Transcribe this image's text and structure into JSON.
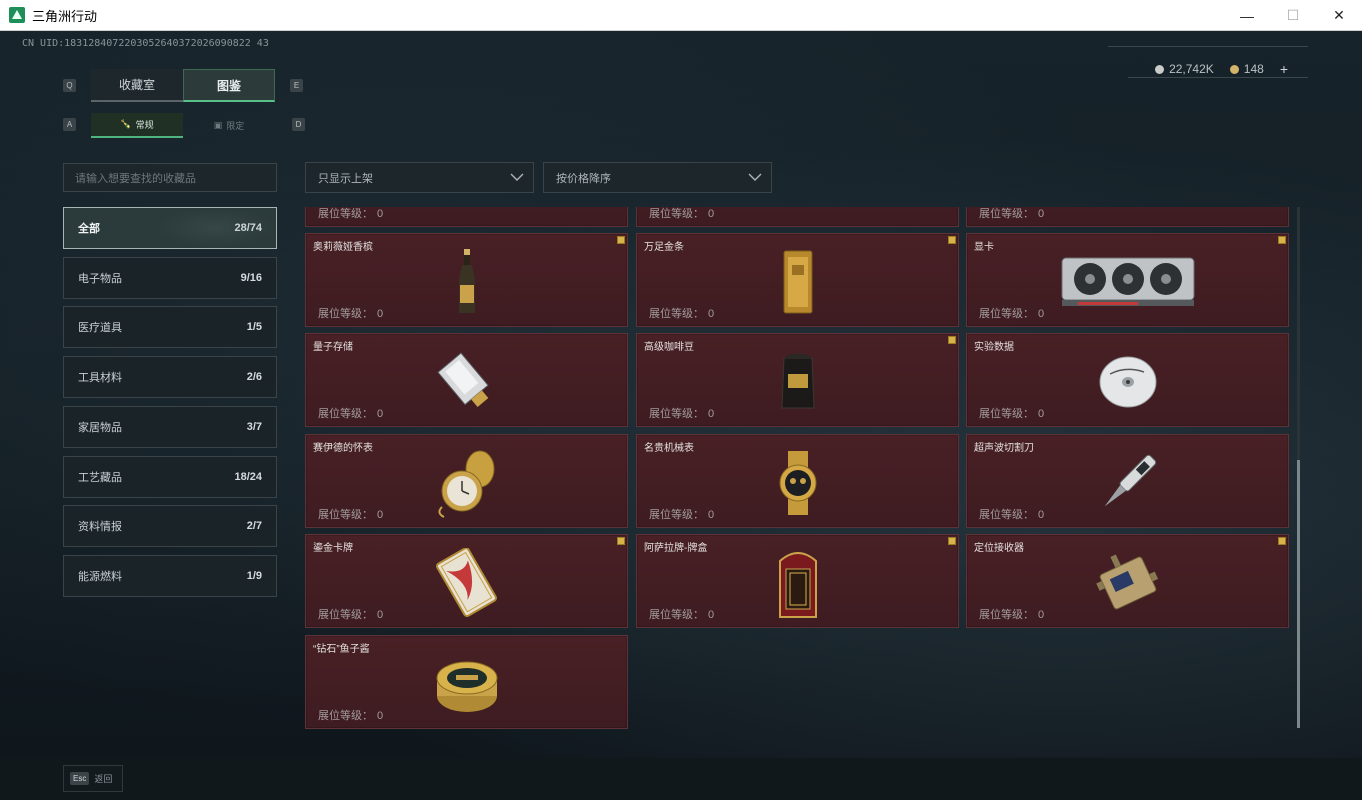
{
  "window": {
    "title": "三角洲行动",
    "minimize": "—",
    "maximize": "☐",
    "close": "✕"
  },
  "header": {
    "uid": "CN UID:1831284072203052640372026090822 43",
    "currency": [
      {
        "icon": "silver-coin-icon",
        "value": "22,742K"
      },
      {
        "icon": "gold-coin-icon",
        "value": "148"
      }
    ],
    "add_label": "+"
  },
  "tabs": {
    "prev_key": "Q",
    "next_key": "E",
    "items": [
      {
        "label": "收藏室"
      },
      {
        "label": "图鉴"
      }
    ],
    "sub_prev_key": "A",
    "sub_next_key": "D",
    "sub_items": [
      {
        "label": "常规"
      },
      {
        "label": "限定"
      }
    ]
  },
  "search": {
    "placeholder": "请输入想要查找的收藏品"
  },
  "filters": {
    "show": "只显示上架",
    "sort": "按价格降序"
  },
  "categories": [
    {
      "label": "全部",
      "count": "28/74"
    },
    {
      "label": "电子物品",
      "count": "9/16"
    },
    {
      "label": "医疗道具",
      "count": "1/5"
    },
    {
      "label": "工具材料",
      "count": "2/6"
    },
    {
      "label": "家居物品",
      "count": "3/7"
    },
    {
      "label": "工艺藏品",
      "count": "18/24"
    },
    {
      "label": "资料情报",
      "count": "2/7"
    },
    {
      "label": "能源燃料",
      "count": "1/9"
    }
  ],
  "level_label": "展位等级：",
  "items": [
    {
      "name": "",
      "level": "0",
      "flag": false,
      "icon": "item-partial"
    },
    {
      "name": "",
      "level": "0",
      "flag": false,
      "icon": "item-partial"
    },
    {
      "name": "",
      "level": "0",
      "flag": false,
      "icon": "item-partial"
    },
    {
      "name": "奥莉薇娅香槟",
      "level": "0",
      "flag": true,
      "icon": "champagne-bottle-icon"
    },
    {
      "name": "万足金条",
      "level": "0",
      "flag": true,
      "icon": "gold-bar-icon"
    },
    {
      "name": "显卡",
      "level": "0",
      "flag": true,
      "icon": "graphics-card-icon"
    },
    {
      "name": "量子存储",
      "level": "0",
      "flag": false,
      "icon": "quantum-storage-icon"
    },
    {
      "name": "高级咖啡豆",
      "level": "0",
      "flag": true,
      "icon": "coffee-bag-icon"
    },
    {
      "name": "实验数据",
      "level": "0",
      "flag": false,
      "icon": "data-disc-icon"
    },
    {
      "name": "赛伊德的怀表",
      "level": "0",
      "flag": false,
      "icon": "pocket-watch-icon"
    },
    {
      "name": "名贵机械表",
      "level": "0",
      "flag": false,
      "icon": "wrist-watch-icon"
    },
    {
      "name": "超声波切割刀",
      "level": "0",
      "flag": false,
      "icon": "ultrasonic-cutter-icon"
    },
    {
      "name": "鎏金卡牌",
      "level": "0",
      "flag": true,
      "icon": "gilded-card-icon"
    },
    {
      "name": "阿萨拉牌-牌盒",
      "level": "0",
      "flag": true,
      "icon": "card-box-icon"
    },
    {
      "name": "定位接收器",
      "level": "0",
      "flag": true,
      "icon": "locator-receiver-icon"
    },
    {
      "name": "“钻石”鱼子酱",
      "level": "0",
      "flag": false,
      "icon": "caviar-tin-icon"
    }
  ],
  "footer": {
    "key": "Esc",
    "label": "返回"
  }
}
